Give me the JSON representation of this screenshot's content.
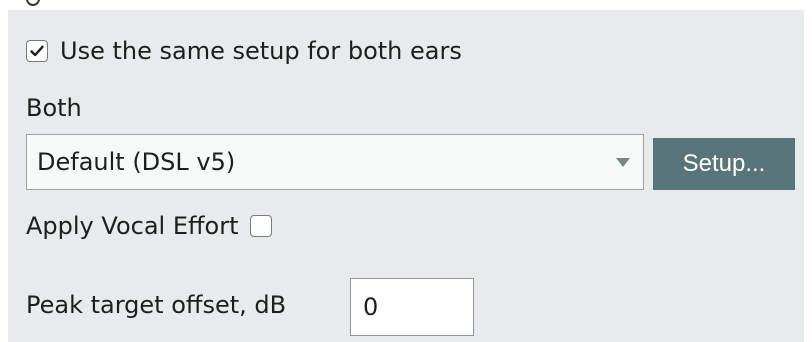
{
  "setup": {
    "same_setup_label": "Use the same setup for both ears",
    "same_setup_checked": true,
    "ear_label": "Both",
    "prescription_select": {
      "selected": "Default (DSL v5)"
    },
    "setup_button_label": "Setup...",
    "vocal_effort_label": "Apply Vocal Effort",
    "vocal_effort_checked": false,
    "peak_offset_label": "Peak target offset, dB",
    "peak_offset_value": "0"
  },
  "icons": {
    "check": "check-icon",
    "dropdown": "dropdown-caret-icon"
  }
}
